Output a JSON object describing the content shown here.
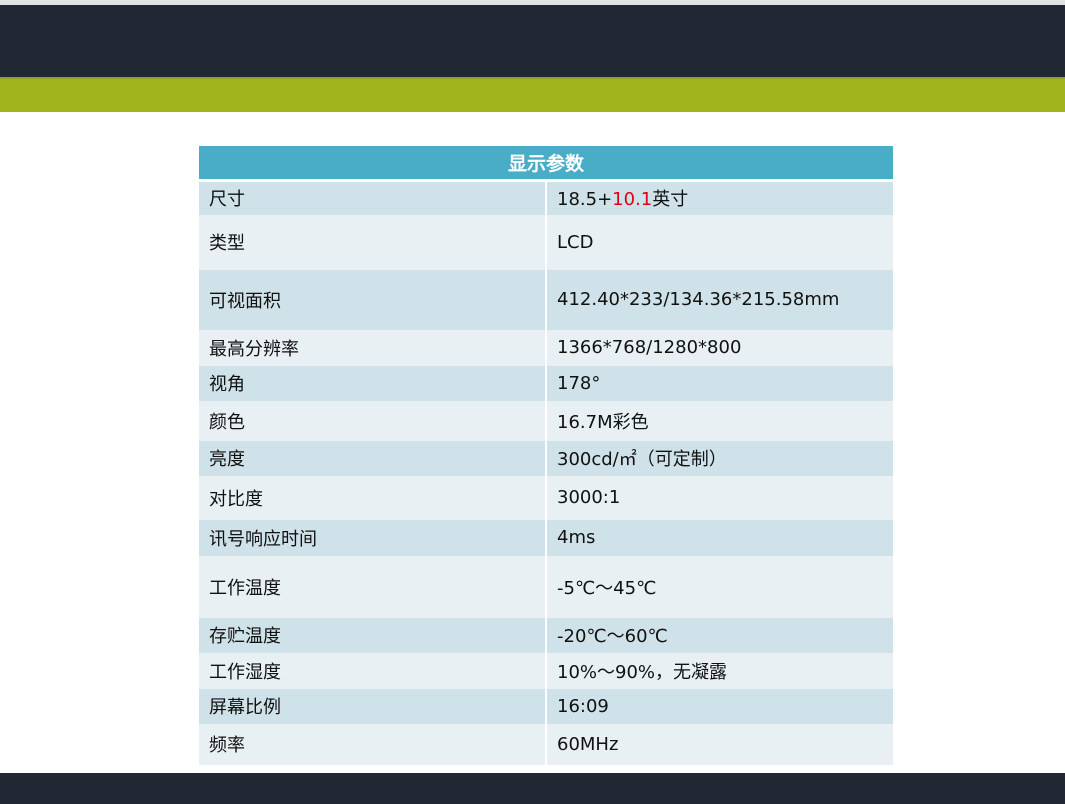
{
  "table": {
    "title": "显示参数",
    "rows": [
      {
        "label": "尺寸",
        "value_prefix": "18.5+",
        "value_highlight": "10.1",
        "value_suffix": "英寸"
      },
      {
        "label": "类型",
        "value": "LCD"
      },
      {
        "label": "可视面积",
        "value": "412.40*233/134.36*215.58mm"
      },
      {
        "label": "最高分辨率",
        "value": "1366*768/1280*800"
      },
      {
        "label": "视角",
        "value": "178°"
      },
      {
        "label": "颜色",
        "value": "16.7M彩色"
      },
      {
        "label": "亮度",
        "value": "300cd/㎡（可定制）"
      },
      {
        "label": "对比度",
        "value": "3000:1"
      },
      {
        "label": "讯号响应时间",
        "value": "4ms"
      },
      {
        "label": "工作温度",
        "value": "-5℃～45℃"
      },
      {
        "label": "存贮温度",
        "value": "-20℃～60℃"
      },
      {
        "label": "工作湿度",
        "value": "10%～90%，无凝露"
      },
      {
        "label": "屏幕比例",
        "value": "16:09"
      },
      {
        "label": "频率",
        "value": "60MHz"
      }
    ]
  },
  "colors": {
    "header": "#212733",
    "green_band": "#a0b51d",
    "table_title_bg": "#4aadc7",
    "row_dark": "#cfe2e9",
    "row_light": "#e8f0f4",
    "highlight": "#e0001a"
  }
}
